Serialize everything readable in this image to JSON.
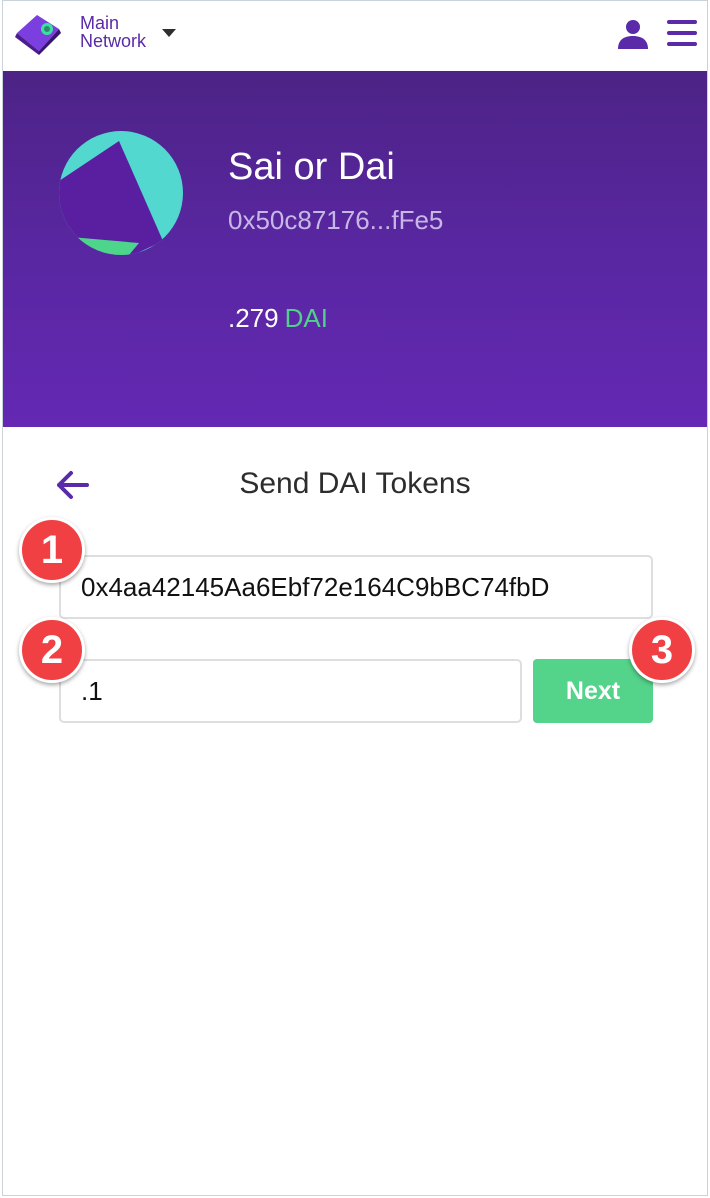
{
  "header": {
    "network_label_line1": "Main",
    "network_label_line2": "Network",
    "icons": {
      "logo": "wallet-logo-icon",
      "caret": "caret-down-icon",
      "user": "user-icon",
      "menu": "hamburger-menu-icon"
    },
    "brand_color": "#5a2aa8"
  },
  "token": {
    "name": "Sai or Dai",
    "address": "0x50c87176...fFe5",
    "balance_amount": ".279",
    "balance_unit": "DAI",
    "avatar_icon": "token-identicon",
    "hero_gradient": [
      "#4d2386",
      "#6428b3"
    ],
    "unit_color": "#4fd18b"
  },
  "send": {
    "title": "Send DAI Tokens",
    "back_icon": "arrow-left-icon",
    "address_value": "0x4aa42145Aa6Ebf72e164C9bBC74fbD",
    "amount_value": ".1",
    "next_label": "Next",
    "next_color": "#54d38a"
  },
  "badges": [
    "1",
    "2",
    "3"
  ],
  "badge_color": "#f04044"
}
